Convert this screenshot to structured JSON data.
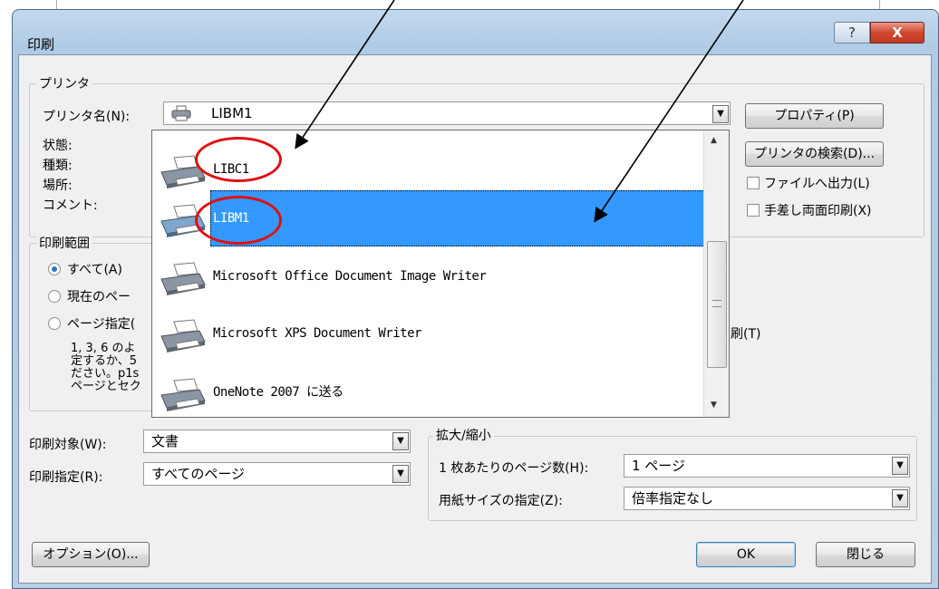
{
  "window": {
    "title": "印刷",
    "help_glyph": "?",
    "close_glyph": "X"
  },
  "printer": {
    "group_label": "プリンタ",
    "name_label": "プリンタ名(N):",
    "name_value": "LIBM1",
    "status_label": "状態:",
    "type_label": "種類:",
    "location_label": "場所:",
    "comment_label": "コメント:",
    "properties_button": "プロパティ(P)",
    "find_printer_button": "プリンタの検索(D)...",
    "print_to_file": "ファイルへ出力(L)",
    "manual_duplex": "手差し両面印刷(X)"
  },
  "dropdown_items": [
    {
      "label": "LIBC1",
      "icon": "printer-icon"
    },
    {
      "label": "LIBM1",
      "icon": "printer-icon",
      "selected": true
    },
    {
      "label": "Microsoft Office Document Image Writer",
      "icon": "printer-icon"
    },
    {
      "label": "Microsoft XPS Document Writer",
      "icon": "printer-icon"
    },
    {
      "label": "OneNote 2007 に送る",
      "icon": "printer-icon"
    }
  ],
  "range": {
    "group_label": "印刷範囲",
    "all": "すべて(A)",
    "current_partial": "現在のペー",
    "pages_partial": "ページ指定(",
    "help_lines": [
      "1, 3, 6 のよ",
      "定するか、5",
      "ださい。p1s",
      "ページとセク"
    ],
    "collate_partial": "刷(T)"
  },
  "print_what": {
    "label": "印刷対象(W):",
    "value": "文書"
  },
  "print_spec": {
    "label": "印刷指定(R):",
    "value": "すべてのページ"
  },
  "zoom": {
    "group_label": "拡大/縮小",
    "pages_per_sheet_label": "1 枚あたりのページ数(H):",
    "pages_per_sheet_value": "1 ページ",
    "paper_size_label": "用紙サイズの指定(Z):",
    "paper_size_value": "倍率指定なし"
  },
  "buttons": {
    "options": "オプション(O)...",
    "ok": "OK",
    "close": "閉じる"
  },
  "colors": {
    "selection": "#3399ff",
    "annotation": "#e01010",
    "close_button": "#c94a31"
  }
}
